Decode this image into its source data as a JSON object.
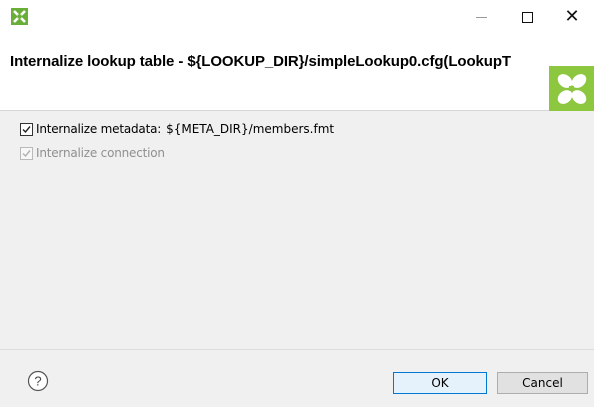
{
  "window": {
    "app_icon": "green-cross-app-icon",
    "controls": {
      "minimize": "minimize-icon",
      "maximize": "maximize-icon",
      "close": "close-icon"
    }
  },
  "header": {
    "title": "Internalize lookup table - ${LOOKUP_DIR}/simpleLookup0.cfg(LookupT",
    "logo": "clover-logo"
  },
  "options": [
    {
      "label": "Internalize metadata:",
      "value": "${META_DIR}/members.fmt",
      "checked": true,
      "enabled": true
    },
    {
      "label": "Internalize connection",
      "checked": true,
      "enabled": false
    }
  ],
  "footer": {
    "help_icon": "help-icon",
    "ok_label": "OK",
    "cancel_label": "Cancel"
  },
  "colors": {
    "accent": "#0078d7",
    "logo_green": "#8dc63f",
    "content_bg": "#f0f0f0"
  }
}
